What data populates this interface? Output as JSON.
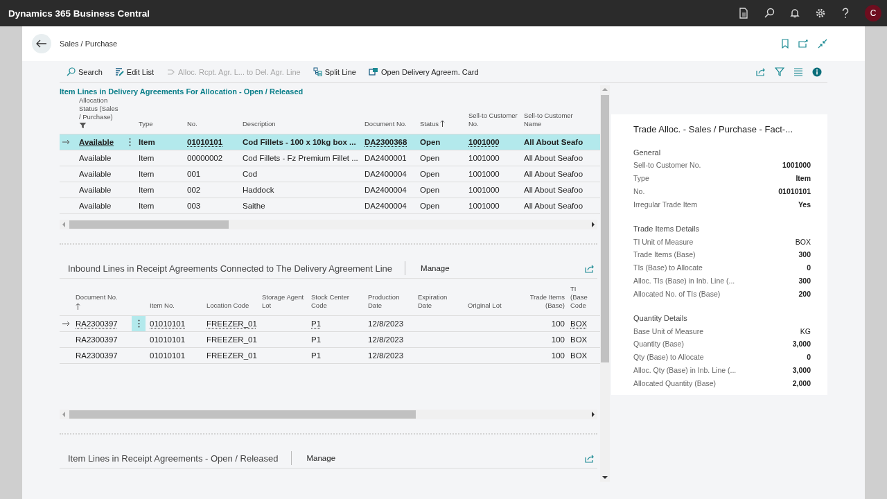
{
  "topbar": {
    "app_title": "Dynamics 365 Business Central",
    "avatar_initial": "C"
  },
  "page": {
    "breadcrumb": "Sales / Purchase"
  },
  "actions": [
    {
      "label": "Search",
      "disabled": false
    },
    {
      "label": "Edit List",
      "disabled": false
    },
    {
      "label": "Alloc. Rcpt. Agr. L... to Del. Agr. Line",
      "disabled": true
    },
    {
      "label": "Split Line",
      "disabled": false
    },
    {
      "label": "Open Delivery Agreem. Card",
      "disabled": false
    }
  ],
  "delivery_lines": {
    "title": "Item Lines in Delivery Agreements For Allocation - Open / Released",
    "columns": [
      {
        "label": "Allocation Status (Sales / Purchase)",
        "filtered": true
      },
      {
        "label": "Type"
      },
      {
        "label": "No."
      },
      {
        "label": "Description"
      },
      {
        "label": "Document No."
      },
      {
        "label": "Status",
        "sorted": true
      },
      {
        "label": "Sell-to Customer No."
      },
      {
        "label": "Sell-to Customer Name"
      }
    ],
    "rows": [
      {
        "current": true,
        "selected": true,
        "cells": [
          "Available",
          "Item",
          "01010101",
          "Cod Fillets - 100 x 10kg box ...",
          "DA2300368",
          "Open",
          "1001000",
          "All About Seafo"
        ]
      },
      {
        "current": false,
        "selected": false,
        "cells": [
          "Available",
          "Item",
          "00000002",
          "Cod Fillets - Fz Premium Fillet ...",
          "DA2400001",
          "Open",
          "1001000",
          "All About Seafoo"
        ]
      },
      {
        "current": false,
        "selected": false,
        "cells": [
          "Available",
          "Item",
          "001",
          "Cod",
          "DA2400004",
          "Open",
          "1001000",
          "All About Seafoo"
        ]
      },
      {
        "current": false,
        "selected": false,
        "cells": [
          "Available",
          "Item",
          "002",
          "Haddock",
          "DA2400004",
          "Open",
          "1001000",
          "All About Seafoo"
        ]
      },
      {
        "current": false,
        "selected": false,
        "cells": [
          "Available",
          "Item",
          "003",
          "Saithe",
          "DA2400004",
          "Open",
          "1001000",
          "All About Seafoo"
        ]
      }
    ]
  },
  "inbound_lines": {
    "title": "Inbound Lines in Receipt Agreements Connected to The Delivery Agreement Line",
    "action": "Manage",
    "columns": [
      {
        "label": "Document No.",
        "sorted": true
      },
      {
        "label": "Item No."
      },
      {
        "label": "Location Code"
      },
      {
        "label": "Storage Agent Lot"
      },
      {
        "label": "Stock Center Code"
      },
      {
        "label": "Production Date"
      },
      {
        "label": "Expiration Date"
      },
      {
        "label": "Original Lot"
      },
      {
        "label": "Trade Items (Base)"
      },
      {
        "label": "TI (Base Code"
      }
    ],
    "rows": [
      {
        "current": true,
        "selected": false,
        "cells": [
          "RA2300397",
          "01010101",
          "FREEZER_01",
          "",
          "P1",
          "12/8/2023",
          "",
          "",
          "100",
          "BOX"
        ]
      },
      {
        "current": false,
        "selected": false,
        "cells": [
          "RA2300397",
          "01010101",
          "FREEZER_01",
          "",
          "P1",
          "12/8/2023",
          "",
          "",
          "100",
          "BOX"
        ]
      },
      {
        "current": false,
        "selected": false,
        "cells": [
          "RA2300397",
          "01010101",
          "FREEZER_01",
          "",
          "P1",
          "12/8/2023",
          "",
          "",
          "100",
          "BOX"
        ]
      }
    ]
  },
  "receipt_lines": {
    "title": "Item Lines in Receipt Agreements - Open / Released",
    "action": "Manage"
  },
  "factbox": {
    "title": "Trade Alloc. - Sales / Purchase - Fact-...",
    "groups": [
      {
        "heading": "General",
        "fields": [
          {
            "label": "Sell-to Customer No.",
            "value": "1001000",
            "bold": true
          },
          {
            "label": "Type",
            "value": "Item",
            "bold": true
          },
          {
            "label": "No.",
            "value": "01010101",
            "bold": true
          },
          {
            "label": "Irregular Trade Item",
            "value": "Yes",
            "bold": true
          }
        ]
      },
      {
        "heading": "Trade Items Details",
        "fields": [
          {
            "label": "TI Unit of Measure",
            "value": "BOX",
            "bold": false
          },
          {
            "label": "Trade Items (Base)",
            "value": "300",
            "bold": true
          },
          {
            "label": "TIs (Base) to Allocate",
            "value": "0",
            "bold": true
          },
          {
            "label": "Alloc. TIs (Base) in Inb. Line (...",
            "value": "300",
            "bold": true
          },
          {
            "label": "Allocated No. of TIs (Base)",
            "value": "200",
            "bold": true
          }
        ]
      },
      {
        "heading": "Quantity Details",
        "fields": [
          {
            "label": "Base Unit of Measure",
            "value": "KG",
            "bold": false
          },
          {
            "label": "Quantity (Base)",
            "value": "3,000",
            "bold": true
          },
          {
            "label": "Qty (Base) to Allocate",
            "value": "0",
            "bold": true
          },
          {
            "label": "Alloc. Qty (Base) in Inb. Line (...",
            "value": "3,000",
            "bold": true
          },
          {
            "label": "Allocated Quantity (Base)",
            "value": "2,000",
            "bold": true
          }
        ]
      }
    ]
  }
}
